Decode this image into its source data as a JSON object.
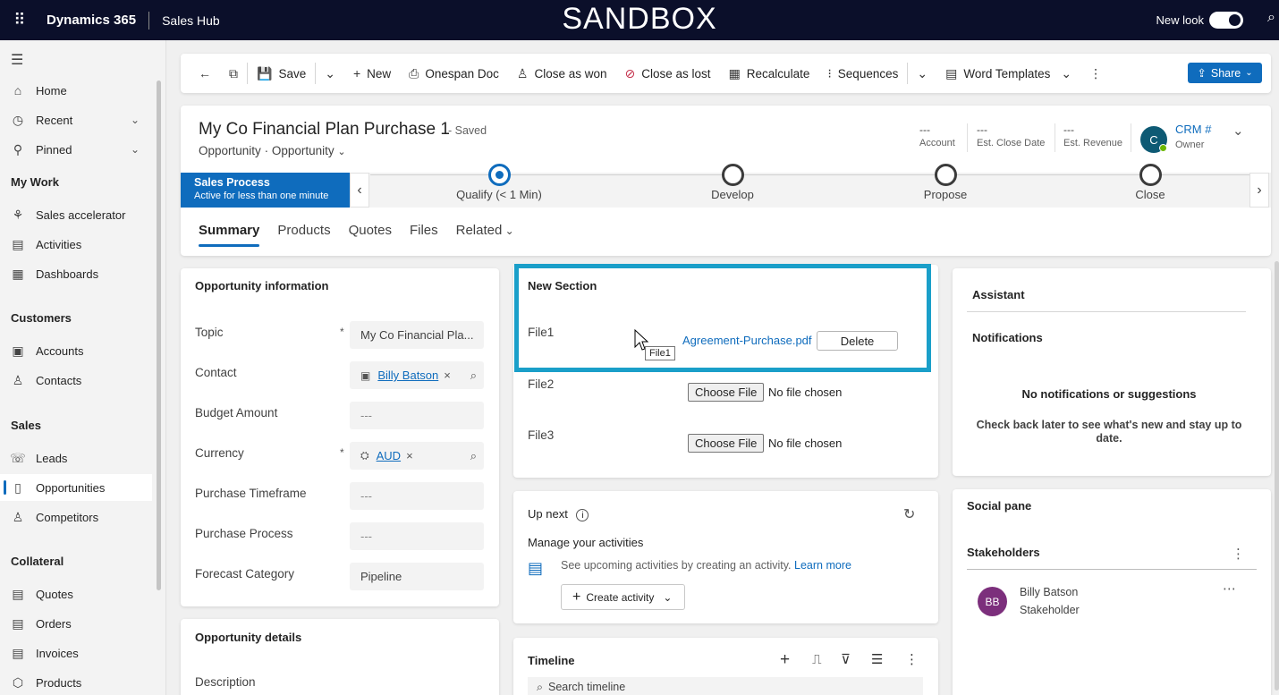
{
  "topbar": {
    "app_name": "Dynamics 365",
    "hub": "Sales Hub",
    "env": "SANDBOX",
    "new_look": "New look"
  },
  "sidebar": {
    "items": [
      {
        "label": "Home",
        "icon": "home-icon"
      },
      {
        "label": "Recent",
        "icon": "clock-icon"
      },
      {
        "label": "Pinned",
        "icon": "pin-icon"
      },
      {
        "label": "Sales accelerator",
        "icon": "rocket-icon"
      },
      {
        "label": "Activities",
        "icon": "clipboard-icon"
      },
      {
        "label": "Dashboards",
        "icon": "dashboard-icon"
      },
      {
        "label": "Accounts",
        "icon": "building-icon"
      },
      {
        "label": "Contacts",
        "icon": "person-icon"
      },
      {
        "label": "Leads",
        "icon": "phone-person-icon"
      },
      {
        "label": "Opportunities",
        "icon": "document-icon"
      },
      {
        "label": "Competitors",
        "icon": "person-search-icon"
      },
      {
        "label": "Quotes",
        "icon": "quote-icon"
      },
      {
        "label": "Orders",
        "icon": "order-icon"
      },
      {
        "label": "Invoices",
        "icon": "invoice-icon"
      },
      {
        "label": "Products",
        "icon": "box-icon"
      }
    ],
    "groups": [
      "My Work",
      "Customers",
      "Sales",
      "Collateral"
    ]
  },
  "commands": {
    "save": "Save",
    "new": "New",
    "onespan": "Onespan Doc",
    "won": "Close as won",
    "lost": "Close as lost",
    "recalc": "Recalculate",
    "sequences": "Sequences",
    "word": "Word Templates",
    "share": "Share"
  },
  "record": {
    "title": "My Co Financial Plan Purchase 1",
    "saved": "- Saved",
    "entity": "Opportunity",
    "form": "Opportunity",
    "account_val": "---",
    "account_lbl": "Account",
    "close_val": "---",
    "close_lbl": "Est. Close Date",
    "revenue_val": "---",
    "revenue_lbl": "Est. Revenue",
    "owner_initial": "C",
    "owner_name": "CRM #",
    "owner_lbl": "Owner"
  },
  "bpf": {
    "name": "Sales Process",
    "status": "Active for less than one minute",
    "stages": [
      "Qualify  (< 1 Min)",
      "Develop",
      "Propose",
      "Close"
    ]
  },
  "tabs": [
    "Summary",
    "Products",
    "Quotes",
    "Files",
    "Related"
  ],
  "opp_info": {
    "title": "Opportunity information",
    "topic_lbl": "Topic",
    "topic_val": "My Co Financial Pla...",
    "contact_lbl": "Contact",
    "contact_val": "Billy Batson",
    "budget_lbl": "Budget Amount",
    "budget_val": "---",
    "currency_lbl": "Currency",
    "currency_val": "AUD",
    "timeframe_lbl": "Purchase Timeframe",
    "timeframe_val": "---",
    "process_lbl": "Purchase Process",
    "process_val": "---",
    "forecast_lbl": "Forecast Category",
    "forecast_val": "Pipeline",
    "req": "*"
  },
  "opp_details": {
    "title": "Opportunity details",
    "desc_lbl": "Description"
  },
  "new_section": {
    "title": "New Section",
    "file1_lbl": "File1",
    "file1_link": "Agreement-Purchase.pdf",
    "delete": "Delete",
    "tooltip": "File1",
    "file2_lbl": "File2",
    "file3_lbl": "File3",
    "choose": "Choose File",
    "nofile": "No file chosen"
  },
  "upnext": {
    "title": "Up next",
    "manage": "Manage your activities",
    "hint": "See upcoming activities by creating an activity.",
    "learn": "Learn more",
    "create": "Create activity"
  },
  "timeline": {
    "title": "Timeline",
    "search": "Search timeline"
  },
  "assistant": {
    "title": "Assistant",
    "notif": "Notifications",
    "none": "No notifications or suggestions",
    "later": "Check back later to see what's new and stay up to date."
  },
  "social": {
    "title": "Social pane",
    "stakeholders": "Stakeholders",
    "person_initials": "BB",
    "person_name": "Billy Batson",
    "person_role": "Stakeholder"
  }
}
